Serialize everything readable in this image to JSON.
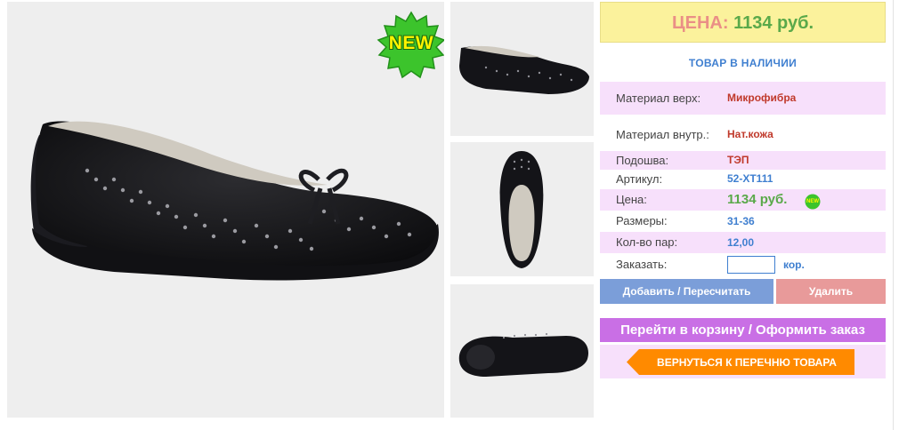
{
  "badge": {
    "new_label": "NEW",
    "mini_label": "NEW"
  },
  "price_box": {
    "label": "ЦЕНА:",
    "value": "1134 руб."
  },
  "stock_status": "ТОВАР В НАЛИЧИИ",
  "specs": [
    {
      "label": "Материал верх:",
      "value": "Микрофибра"
    },
    {
      "label": "Материал внутр.:",
      "value": "Нат.кожа"
    },
    {
      "label": "Подошва:",
      "value": "ТЭП"
    },
    {
      "label": "Артикул:",
      "value": "52-ХТ111"
    },
    {
      "label": "Цена:",
      "value": "1134 руб."
    },
    {
      "label": "Размеры:",
      "value": "31-36"
    },
    {
      "label": "Кол-во пар:",
      "value": "12,00"
    }
  ],
  "order": {
    "label": "Заказать:",
    "value": "",
    "unit": "кор."
  },
  "buttons": {
    "add": "Добавить / Пересчитать",
    "delete": "Удалить",
    "cart": "Перейти в корзину / Оформить заказ",
    "back": "ВЕРНУТЬСЯ К ПЕРЕЧНЮ ТОВАРА"
  },
  "colors": {
    "price_bg": "#fbf29c",
    "price_label": "#ea8f86",
    "price_value": "#5aa94a",
    "row_highlight": "#f7e0fb",
    "link_blue": "#3f7fd0",
    "add_button": "#7b9ed9",
    "delete_button": "#e89a9a",
    "cart_button": "#c96fe5",
    "back_button": "#ff8a00"
  },
  "icons": [
    "new-badge-icon",
    "shoe-photo",
    "shoe-thumbnail"
  ]
}
